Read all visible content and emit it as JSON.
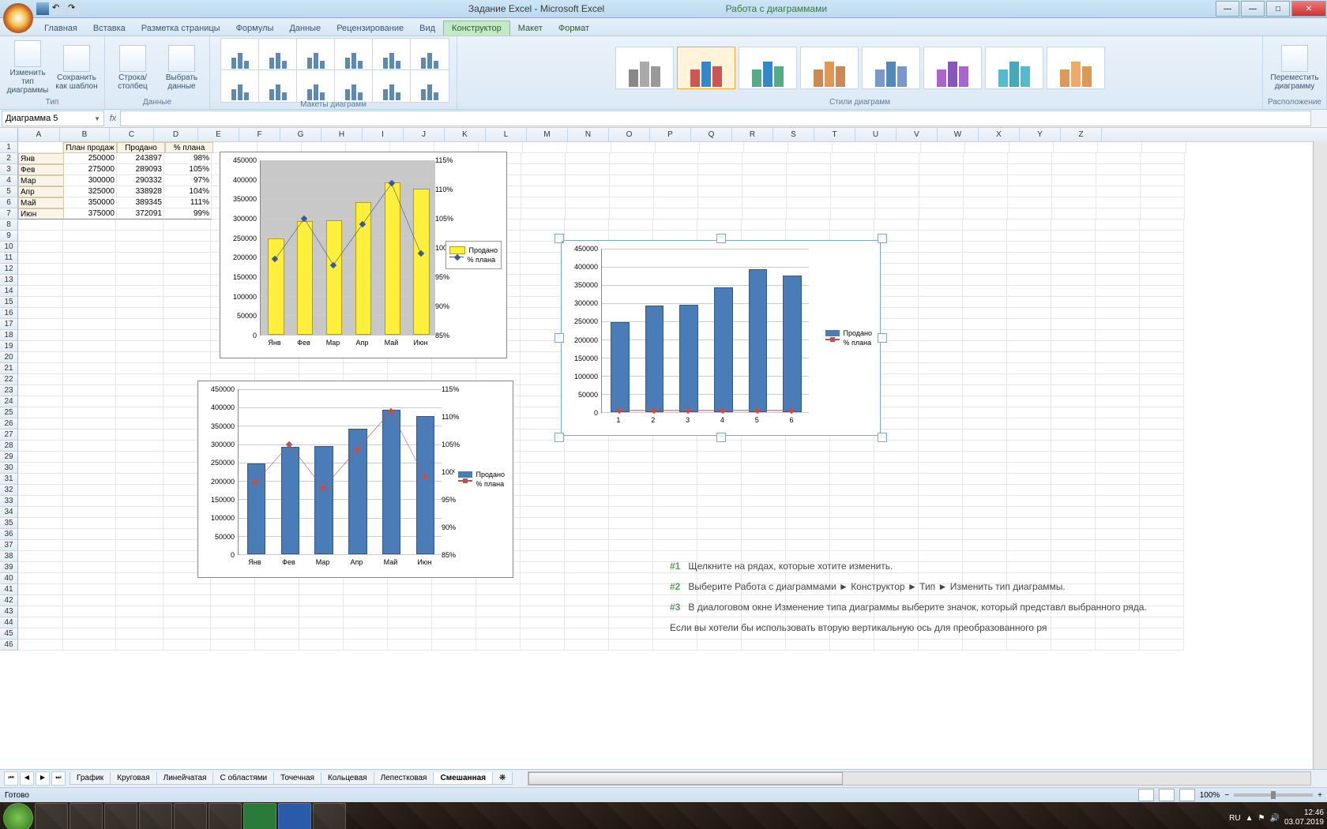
{
  "window": {
    "doc_title": "Задание Excel - Microsoft Excel",
    "context_title": "Работа с диаграммами",
    "min": "—",
    "max": "□",
    "close": "✕"
  },
  "tabs": {
    "home": "Главная",
    "insert": "Вставка",
    "layout": "Разметка страницы",
    "formulas": "Формулы",
    "data": "Данные",
    "review": "Рецензирование",
    "view": "Вид",
    "design": "Конструктор",
    "layout2": "Макет",
    "format": "Формат"
  },
  "ribbon": {
    "type": {
      "label": "Тип",
      "change": "Изменить тип диаграммы",
      "save": "Сохранить как шаблон"
    },
    "data": {
      "label": "Данные",
      "switch": "Строка/столбец",
      "select": "Выбрать данные"
    },
    "layouts": {
      "label": "Макеты диаграмм"
    },
    "styles": {
      "label": "Стили диаграмм"
    },
    "location": {
      "label": "Расположение",
      "move": "Переместить диаграмму"
    }
  },
  "namebox": "Диаграмма 5",
  "fx": "fx",
  "columns": [
    "A",
    "B",
    "C",
    "D",
    "E",
    "F",
    "G",
    "H",
    "I",
    "J",
    "K",
    "L",
    "M",
    "N",
    "O",
    "P",
    "Q",
    "R",
    "S",
    "T",
    "U",
    "V",
    "W",
    "X",
    "Y",
    "Z"
  ],
  "table": {
    "headers": {
      "b": "План продаж",
      "c": "Продано",
      "d": "% плана"
    },
    "rows": [
      {
        "a": "Янв",
        "b": "250000",
        "c": "243897",
        "d": "98%"
      },
      {
        "a": "Фев",
        "b": "275000",
        "c": "289093",
        "d": "105%"
      },
      {
        "a": "Мар",
        "b": "300000",
        "c": "290332",
        "d": "97%"
      },
      {
        "a": "Апр",
        "b": "325000",
        "c": "338928",
        "d": "104%"
      },
      {
        "a": "Май",
        "b": "350000",
        "c": "389345",
        "d": "111%"
      },
      {
        "a": "Июн",
        "b": "375000",
        "c": "372091",
        "d": "99%"
      }
    ]
  },
  "chart_data": [
    {
      "id": "chart1",
      "type": "combo",
      "categories": [
        "Янв",
        "Фев",
        "Мар",
        "Апр",
        "Май",
        "Июн"
      ],
      "series": [
        {
          "name": "Продано",
          "type": "bar",
          "axis": "y1",
          "values": [
            243897,
            289093,
            290332,
            338928,
            389345,
            372091
          ]
        },
        {
          "name": "% плана",
          "type": "line",
          "axis": "y2",
          "values": [
            98,
            105,
            97,
            104,
            111,
            99
          ]
        }
      ],
      "y1": {
        "min": 0,
        "max": 450000,
        "step": 50000
      },
      "y2": {
        "min": 85,
        "max": 115,
        "step": 5,
        "suffix": "%"
      },
      "bar_color": "yellow",
      "plot_bg": "gray"
    },
    {
      "id": "chart2",
      "type": "combo",
      "categories": [
        "Янв",
        "Фев",
        "Мар",
        "Апр",
        "Май",
        "Июн"
      ],
      "series": [
        {
          "name": "Продано",
          "type": "bar",
          "axis": "y1",
          "values": [
            243897,
            289093,
            290332,
            338928,
            389345,
            372091
          ]
        },
        {
          "name": "% плана",
          "type": "line",
          "axis": "y2",
          "values": [
            98,
            105,
            97,
            104,
            111,
            99
          ]
        }
      ],
      "y1": {
        "min": 0,
        "max": 450000,
        "step": 50000
      },
      "y2": {
        "min": 85,
        "max": 115,
        "step": 5,
        "suffix": "%"
      },
      "bar_color": "blue",
      "line_color": "red"
    },
    {
      "id": "chart3",
      "type": "bar",
      "categories": [
        "1",
        "2",
        "3",
        "4",
        "5",
        "6"
      ],
      "series": [
        {
          "name": "Продано",
          "type": "bar",
          "values": [
            243897,
            289093,
            290332,
            338928,
            389345,
            372091
          ]
        },
        {
          "name": "% плана",
          "type": "line",
          "values": [
            98,
            105,
            97,
            104,
            111,
            99
          ]
        }
      ],
      "y1": {
        "min": 0,
        "max": 450000,
        "step": 50000
      },
      "bar_color": "blue",
      "line_color": "red",
      "selected": true
    }
  ],
  "instructions": [
    {
      "n": "#1",
      "t": "Щелкните на рядах, которые хотите изменить."
    },
    {
      "n": "#2",
      "t": "Выберите Работа с диаграммами ► Конструктор ► Тип ► Изменить тип диаграммы."
    },
    {
      "n": "#3",
      "t": "В диалоговом окне Изменение типа диаграммы выберите значок, который представл выбранного ряда."
    },
    {
      "n": "",
      "t": "Если вы хотели бы использовать вторую вертикальную ось для преобразованного ря"
    }
  ],
  "sheets": [
    "График",
    "Круговая",
    "Линейчатая",
    "С областями",
    "Точечная",
    "Кольцевая",
    "Лепестковая",
    "Смешанная"
  ],
  "active_sheet": "Смешанная",
  "status": {
    "ready": "Готово",
    "zoom": "100%",
    "lang": "RU"
  },
  "clock": {
    "time": "12:46",
    "date": "03.07.2019"
  }
}
